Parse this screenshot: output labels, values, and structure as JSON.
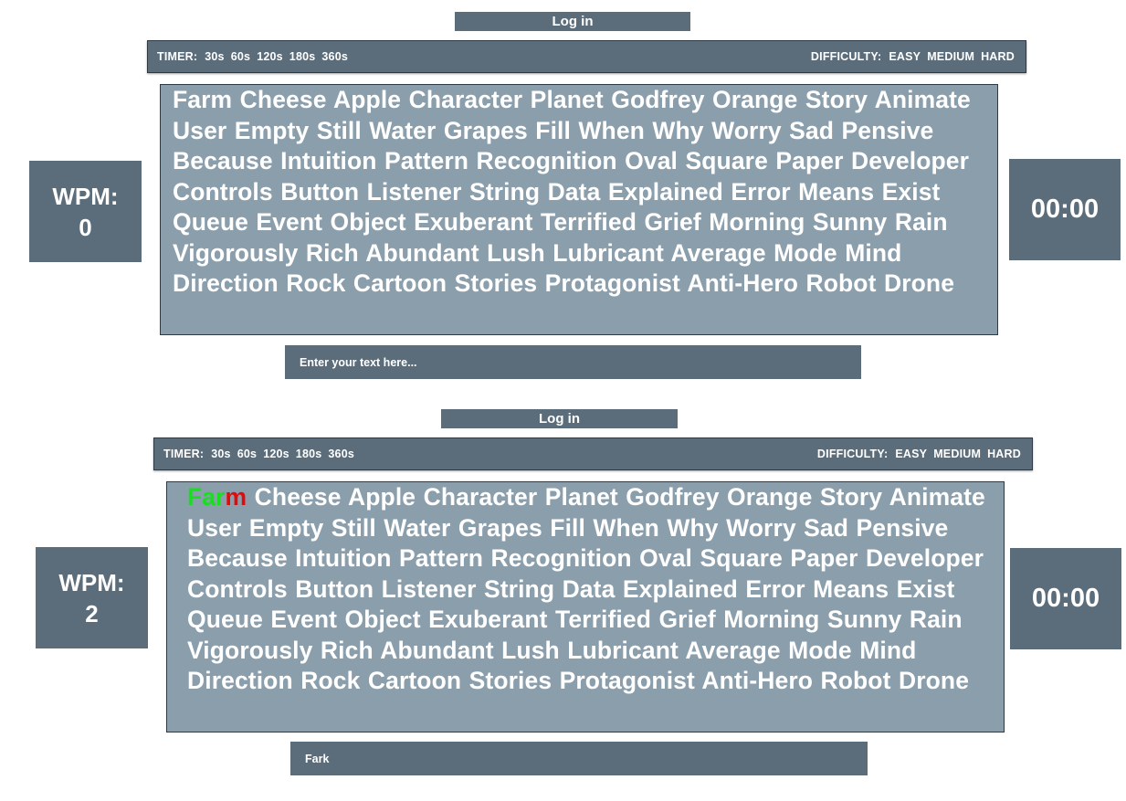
{
  "screens": [
    {
      "login_label": "Log in",
      "timer_label": "TIMER:",
      "timer_options": [
        "30s",
        "60s",
        "120s",
        "180s",
        "360s"
      ],
      "difficulty_label": "DIFFICULTY:",
      "difficulty_options": [
        "EASY",
        "MEDIUM",
        "HARD"
      ],
      "typed_correct": "",
      "typed_wrong": "",
      "words_rest": "Farm Cheese Apple Character Planet Godfrey Orange Story Animate User Empty Still Water Grapes Fill When Why Worry Sad Pensive Because Intuition Pattern Recognition Oval Square Paper Developer Controls Button Listener String Data Explained Error Means Exist Queue Event Object Exuberant Terrified Grief Morning Sunny Rain Vigorously Rich Abundant Lush Lubricant Average Mode Mind Direction Rock Cartoon Stories Protagonist Anti-Hero Robot Drone",
      "wpm_label": "WPM:",
      "wpm_value": "0",
      "timer_display": "00:00",
      "input_text": "Enter your text here..."
    },
    {
      "login_label": "Log in",
      "timer_label": "TIMER:",
      "timer_options": [
        "30s",
        "60s",
        "120s",
        "180s",
        "360s"
      ],
      "difficulty_label": "DIFFICULTY:",
      "difficulty_options": [
        "EASY",
        "MEDIUM",
        "HARD"
      ],
      "typed_correct": "Far",
      "typed_wrong": "m",
      "words_rest": " Cheese Apple Character Planet Godfrey Orange Story Animate User Empty Still Water Grapes Fill When Why Worry Sad Pensive Because Intuition Pattern Recognition Oval Square Paper Developer Controls Button Listener String Data Explained Error Means Exist Queue Event Object Exuberant Terrified Grief Morning Sunny Rain Vigorously Rich Abundant Lush Lubricant Average Mode Mind Direction Rock Cartoon Stories Protagonist Anti-Hero Robot Drone",
      "wpm_label": "WPM:",
      "wpm_value": "2",
      "timer_display": "00:00",
      "input_text": "Fark"
    }
  ],
  "colors": {
    "panel_dark": "#5b6d7b",
    "words_bg": "#8a9eac",
    "correct_letter": "#15e01b",
    "wrong_letter": "#e20a0a"
  }
}
